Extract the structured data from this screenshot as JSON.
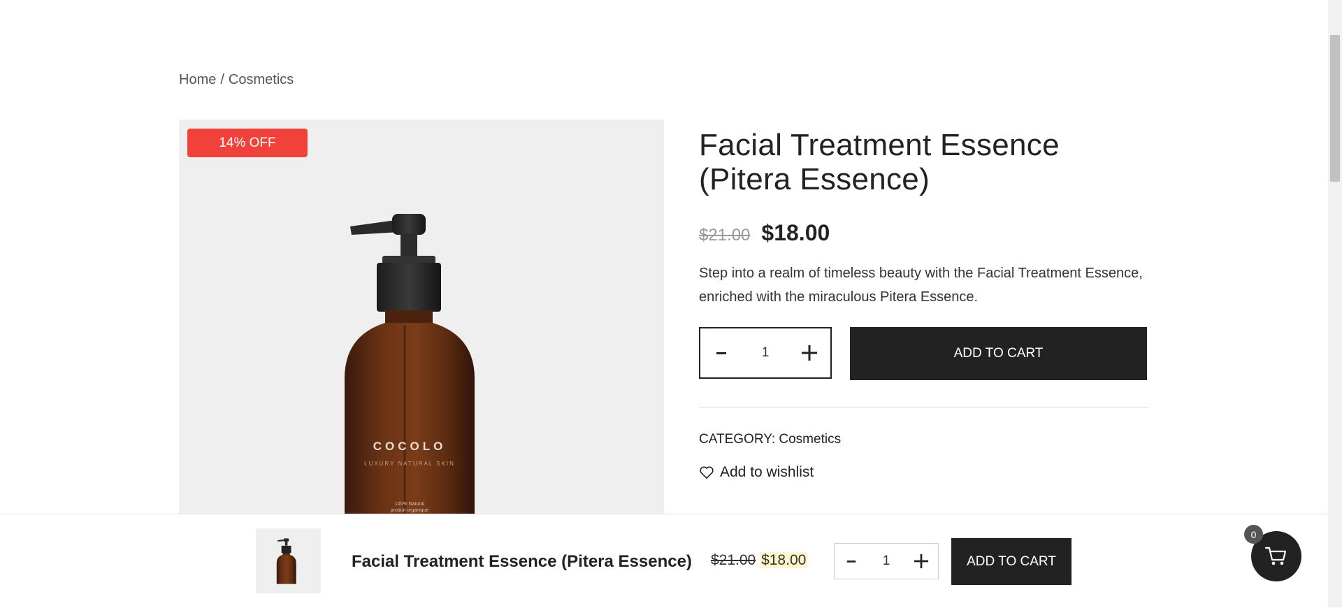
{
  "breadcrumb": {
    "home": "Home",
    "separator": "/",
    "category": "Cosmetics"
  },
  "product": {
    "badge": "14% OFF",
    "title": "Facial Treatment Essence (Pitera Essence)",
    "old_price": "$21.00",
    "new_price": "$18.00",
    "description": "Step into a realm of timeless beauty with the Facial Treatment Essence, enriched with the miraculous Pitera Essence.",
    "quantity": "1",
    "add_to_cart": "ADD TO CART",
    "category_label": "CATEGORY:",
    "category_value": "Cosmetics",
    "wishlist": "Add to wishlist",
    "bottle_brand": "COCOLO",
    "bottle_tagline": "LUXURY NATURAL SKIN",
    "bottle_small1": "100% Natural",
    "bottle_small2": "produit organique"
  },
  "sticky": {
    "title": "Facial Treatment Essence (Pitera Essence)",
    "old_price": "$21.00",
    "new_price": "$18.00",
    "quantity": "1",
    "add_to_cart": "ADD TO CART"
  },
  "cart": {
    "count": "0"
  },
  "colors": {
    "badge": "#f0413b",
    "button": "#222222",
    "price_highlight": "#fdf5c9"
  },
  "icons": {
    "minus": "minus-icon",
    "plus": "plus-icon",
    "heart": "heart-icon",
    "cart": "cart-icon"
  }
}
